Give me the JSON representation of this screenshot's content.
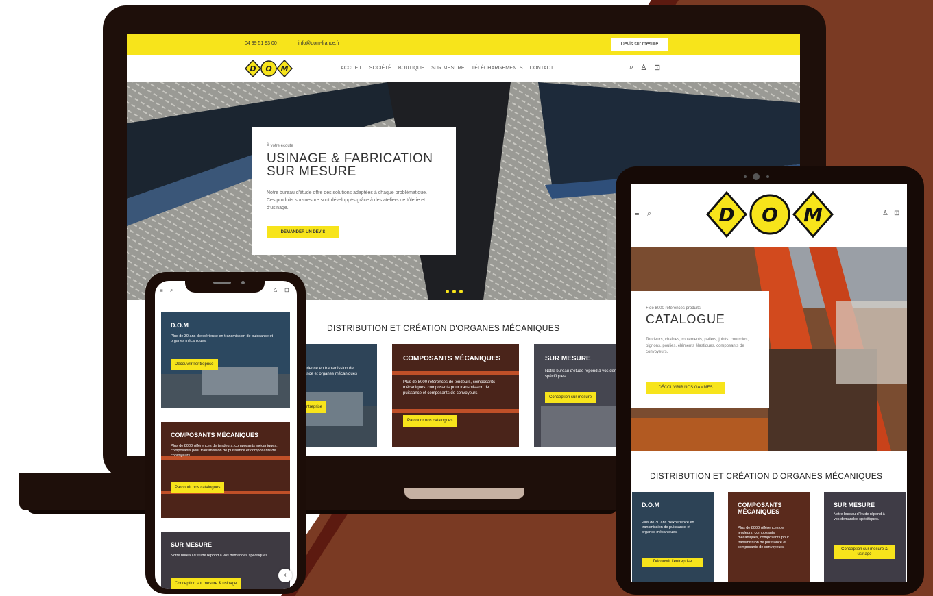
{
  "brand": {
    "name": "DOM",
    "letters": [
      "D",
      "O",
      "M"
    ],
    "accent": "#f7e41b",
    "frame": "#1e0f0a",
    "backdrop": "#7a3a23"
  },
  "desktop": {
    "topbar": {
      "phone": "04 99 51 93 00",
      "email": "info@dom-france.fr",
      "quote_button": "Devis sur mesure"
    },
    "nav": [
      "ACCUEIL",
      "SOCIÉTÉ",
      "BOUTIQUE",
      "SUR MESURE",
      "TÉLÉCHARGEMENTS",
      "CONTACT"
    ],
    "icons": [
      "search-icon",
      "user-icon",
      "cart-icon"
    ],
    "hero": {
      "kicker": "À votre écoute",
      "title": "USINAGE & FABRICATION SUR MESURE",
      "description": "Notre bureau d'étude offre des solutions adaptées à chaque problématique. Ces produits sur-mesure sont développés grâce à des ateliers de tôlerie et d'usinage.",
      "cta": "DEMANDER UN DEVIS"
    },
    "section_title": "DISTRIBUTION ET CRÉATION D'ORGANES MÉCANIQUES",
    "tiles": [
      {
        "title": "",
        "description": "d'expérience en transmission de puissance et organes mécaniques",
        "button": "Découvrir l'entreprise"
      },
      {
        "title": "COMPOSANTS MÉCANIQUES",
        "description": "Plus de 8000 références de tendeurs, composants mécaniques, composants pour transmission de puissance et composants de convoyeurs.",
        "button": "Parcourir nos catalogues"
      },
      {
        "title": "SUR MESURE",
        "description": "Notre bureau d'étude répond à vos demandes spécifiques.",
        "button": "Conception sur mesure"
      }
    ]
  },
  "tablet": {
    "icons": [
      "menu-icon",
      "search-icon",
      "user-icon",
      "cart-icon"
    ],
    "hero": {
      "kicker": "+ de 8000 références produits",
      "title": "CATALOGUE",
      "description": "Tendeurs, chaînes, roulements, paliers, joints, courroies, pignons, poulies, éléments élastiques, composants de convoyeurs.",
      "cta": "DÉCOUVRIR NOS GAMMES"
    },
    "section_title": "DISTRIBUTION ET CRÉATION D'ORGANES MÉCANIQUES",
    "tiles": [
      {
        "title": "D.O.M",
        "description": "Plus de 30 ans d'expérience en transmission de puissance et organes mécaniques.",
        "button": "Découvrir l'entreprise"
      },
      {
        "title": "COMPOSANTS MÉCANIQUES",
        "description": "Plus de 8000 références de tendeurs, composants mécaniques, composants pour transmission de puissance et composants de convoyeurs.",
        "button": ""
      },
      {
        "title": "SUR MESURE",
        "description": "Notre bureau d'étude répond à vos demandes spécifiques.",
        "button": "Conception sur mesure & usinage"
      }
    ]
  },
  "phone": {
    "icons": [
      "menu-icon",
      "search-icon",
      "user-icon",
      "cart-icon"
    ],
    "cards": [
      {
        "title": "D.O.M",
        "description": "Plus de 30 ans d'expérience en transmission de puissance et organes mécaniques.",
        "button": "Découvrir l'entreprise"
      },
      {
        "title": "COMPOSANTS MÉCANIQUES",
        "description": "Plus de 8000 références de tendeurs, composants mécaniques, composants pour transmission de puissance et composants de convoyeurs.",
        "button": "Parcourir nos catalogues"
      },
      {
        "title": "SUR MESURE",
        "description": "Notre bureau d'étude répond à vos demandes spécifiques.",
        "button": "Conception sur mesure & usinage"
      }
    ],
    "scroll_top": "‹"
  }
}
